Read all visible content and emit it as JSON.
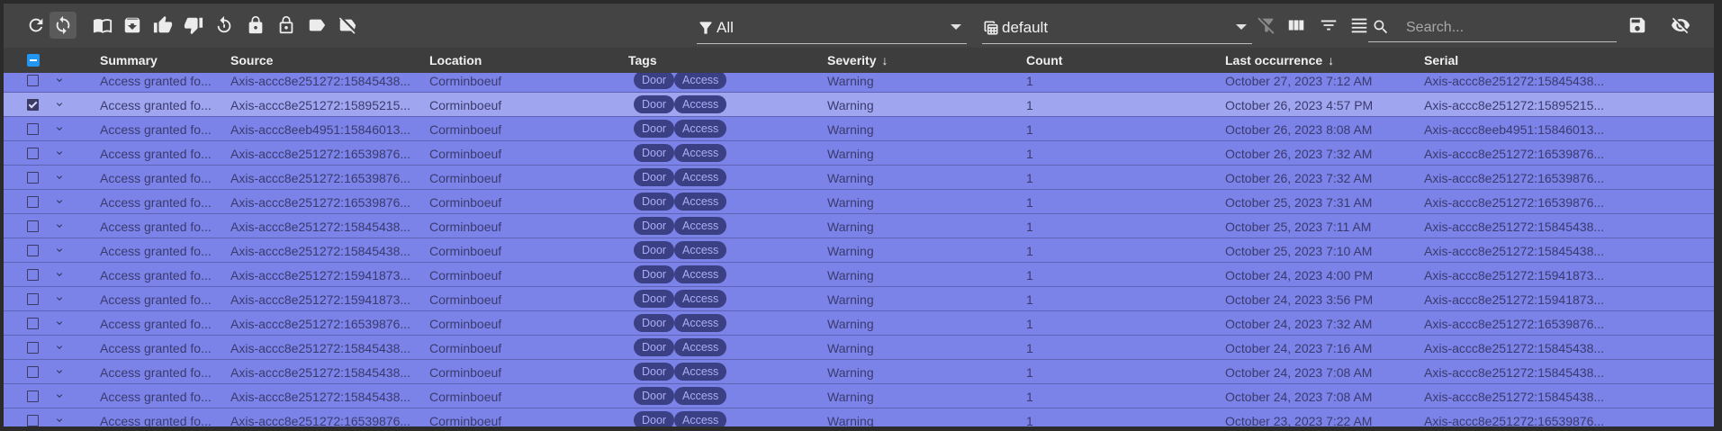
{
  "toolbar": {
    "filter_select": {
      "value": "All"
    },
    "view_select": {
      "value": "default"
    },
    "search": {
      "placeholder": "Search..."
    }
  },
  "columns": {
    "summary": "Summary",
    "source": "Source",
    "location": "Location",
    "tags": "Tags",
    "severity": "Severity",
    "count": "Count",
    "last_occurrence": "Last occurrence",
    "serial": "Serial"
  },
  "sort_arrow": "↓",
  "rows": [
    {
      "summary": "Access granted fo...",
      "source": "Axis-accc8e251272:15845438...",
      "location": "Corminboeuf",
      "tags": [
        "Door",
        "Access"
      ],
      "severity": "Warning",
      "count": "1",
      "last": "October 27, 2023 7:12 AM",
      "serial": "Axis-accc8e251272:15845438...",
      "checked": false
    },
    {
      "summary": "Access granted fo...",
      "source": "Axis-accc8e251272:15895215...",
      "location": "Corminboeuf",
      "tags": [
        "Door",
        "Access"
      ],
      "severity": "Warning",
      "count": "1",
      "last": "October 26, 2023 4:57 PM",
      "serial": "Axis-accc8e251272:15895215...",
      "checked": true
    },
    {
      "summary": "Access granted fo...",
      "source": "Axis-accc8eeb4951:15846013...",
      "location": "Corminboeuf",
      "tags": [
        "Door",
        "Access"
      ],
      "severity": "Warning",
      "count": "1",
      "last": "October 26, 2023 8:08 AM",
      "serial": "Axis-accc8eeb4951:15846013...",
      "checked": false
    },
    {
      "summary": "Access granted fo...",
      "source": "Axis-accc8e251272:16539876...",
      "location": "Corminboeuf",
      "tags": [
        "Door",
        "Access"
      ],
      "severity": "Warning",
      "count": "1",
      "last": "October 26, 2023 7:32 AM",
      "serial": "Axis-accc8e251272:16539876...",
      "checked": false
    },
    {
      "summary": "Access granted fo...",
      "source": "Axis-accc8e251272:16539876...",
      "location": "Corminboeuf",
      "tags": [
        "Door",
        "Access"
      ],
      "severity": "Warning",
      "count": "1",
      "last": "October 26, 2023 7:32 AM",
      "serial": "Axis-accc8e251272:16539876...",
      "checked": false
    },
    {
      "summary": "Access granted fo...",
      "source": "Axis-accc8e251272:16539876...",
      "location": "Corminboeuf",
      "tags": [
        "Door",
        "Access"
      ],
      "severity": "Warning",
      "count": "1",
      "last": "October 25, 2023 7:31 AM",
      "serial": "Axis-accc8e251272:16539876...",
      "checked": false
    },
    {
      "summary": "Access granted fo...",
      "source": "Axis-accc8e251272:15845438...",
      "location": "Corminboeuf",
      "tags": [
        "Door",
        "Access"
      ],
      "severity": "Warning",
      "count": "1",
      "last": "October 25, 2023 7:11 AM",
      "serial": "Axis-accc8e251272:15845438...",
      "checked": false
    },
    {
      "summary": "Access granted fo...",
      "source": "Axis-accc8e251272:15845438...",
      "location": "Corminboeuf",
      "tags": [
        "Door",
        "Access"
      ],
      "severity": "Warning",
      "count": "1",
      "last": "October 25, 2023 7:10 AM",
      "serial": "Axis-accc8e251272:15845438...",
      "checked": false
    },
    {
      "summary": "Access granted fo...",
      "source": "Axis-accc8e251272:15941873...",
      "location": "Corminboeuf",
      "tags": [
        "Door",
        "Access"
      ],
      "severity": "Warning",
      "count": "1",
      "last": "October 24, 2023 4:00 PM",
      "serial": "Axis-accc8e251272:15941873...",
      "checked": false
    },
    {
      "summary": "Access granted fo...",
      "source": "Axis-accc8e251272:15941873...",
      "location": "Corminboeuf",
      "tags": [
        "Door",
        "Access"
      ],
      "severity": "Warning",
      "count": "1",
      "last": "October 24, 2023 3:56 PM",
      "serial": "Axis-accc8e251272:15941873...",
      "checked": false
    },
    {
      "summary": "Access granted fo...",
      "source": "Axis-accc8e251272:16539876...",
      "location": "Corminboeuf",
      "tags": [
        "Door",
        "Access"
      ],
      "severity": "Warning",
      "count": "1",
      "last": "October 24, 2023 7:32 AM",
      "serial": "Axis-accc8e251272:16539876...",
      "checked": false
    },
    {
      "summary": "Access granted fo...",
      "source": "Axis-accc8e251272:15845438...",
      "location": "Corminboeuf",
      "tags": [
        "Door",
        "Access"
      ],
      "severity": "Warning",
      "count": "1",
      "last": "October 24, 2023 7:16 AM",
      "serial": "Axis-accc8e251272:15845438...",
      "checked": false
    },
    {
      "summary": "Access granted fo...",
      "source": "Axis-accc8e251272:15845438...",
      "location": "Corminboeuf",
      "tags": [
        "Door",
        "Access"
      ],
      "severity": "Warning",
      "count": "1",
      "last": "October 24, 2023 7:08 AM",
      "serial": "Axis-accc8e251272:15845438...",
      "checked": false
    },
    {
      "summary": "Access granted fo...",
      "source": "Axis-accc8e251272:15845438...",
      "location": "Corminboeuf",
      "tags": [
        "Door",
        "Access"
      ],
      "severity": "Warning",
      "count": "1",
      "last": "October 24, 2023 7:08 AM",
      "serial": "Axis-accc8e251272:15845438...",
      "checked": false
    },
    {
      "summary": "Access granted fo...",
      "source": "Axis-accc8e251272:16539876...",
      "location": "Corminboeuf",
      "tags": [
        "Door",
        "Access"
      ],
      "severity": "Warning",
      "count": "1",
      "last": "October 23, 2023 7:22 AM",
      "serial": "Axis-accc8e251272:16539876...",
      "checked": false
    }
  ]
}
